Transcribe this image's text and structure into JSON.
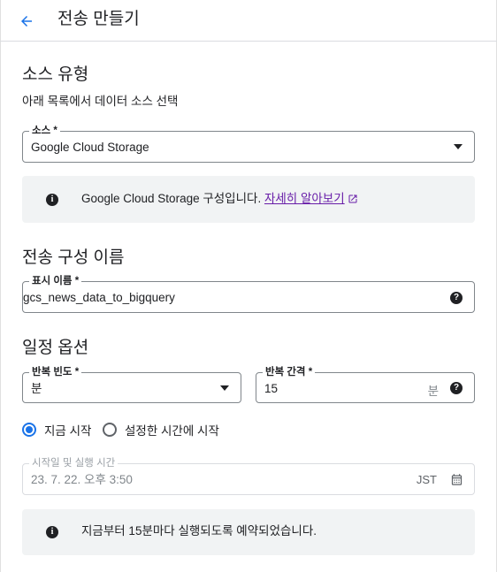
{
  "header": {
    "title": "전송 만들기"
  },
  "source_section": {
    "title": "소스 유형",
    "description": "아래 목록에서 데이터 소스 선택",
    "source_select": {
      "label": "소스 *",
      "value": "Google Cloud Storage"
    },
    "info": {
      "text": "Google Cloud Storage 구성입니다. ",
      "link": "자세히 알아보기"
    }
  },
  "config_section": {
    "title": "전송 구성 이름",
    "display_name": {
      "label": "표시 이름 *",
      "value": "gcs_news_data_to_bigquery"
    }
  },
  "schedule_section": {
    "title": "일정 옵션",
    "repeat_frequency": {
      "label": "반복 빈도 *",
      "value": "분"
    },
    "repeat_interval": {
      "label": "반복 간격 *",
      "value": "15",
      "suffix": "분"
    },
    "radio_options": [
      {
        "label": "지금 시작",
        "checked": true
      },
      {
        "label": "설정한 시간에 시작",
        "checked": false
      }
    ],
    "start_datetime": {
      "label": "시작일 및 실행 시간",
      "value": "23. 7. 22. 오후 3:50",
      "timezone": "JST"
    },
    "info": {
      "text": "지금부터 15분마다 실행되도록 예약되었습니다."
    }
  },
  "colors": {
    "accent": "#1a73e8",
    "link": "#681da8",
    "info_bg": "#f1f3f4"
  }
}
